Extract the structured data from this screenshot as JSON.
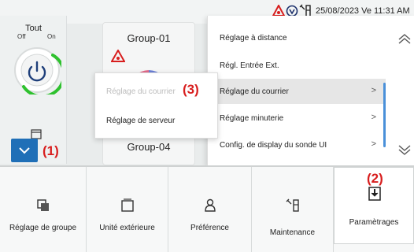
{
  "status": {
    "datetime": "25/08/2023 Ve 11:31 AM"
  },
  "left": {
    "title": "Tout",
    "off": "Off",
    "on": "On"
  },
  "groups": [
    {
      "name": "Group-01"
    },
    {
      "name": "Group-04"
    }
  ],
  "submenu": {
    "items": [
      {
        "label": "Réglage à distance",
        "chevron": false
      },
      {
        "label": "Régl. Entrée Ext.",
        "chevron": false
      },
      {
        "label": "Réglage du courrier",
        "chevron": true,
        "active": true
      },
      {
        "label": "Réglage minuterie",
        "chevron": true
      },
      {
        "label": "Config. de display du sonde UI",
        "chevron": true
      }
    ]
  },
  "popup": {
    "items": [
      {
        "label": "Réglage du courrier",
        "disabled": true
      },
      {
        "label": "Réglage de serveur",
        "disabled": false
      }
    ]
  },
  "annotations": {
    "a1": "(1)",
    "a2": "(2)",
    "a3": "(3)"
  },
  "bottom": {
    "items": [
      {
        "label": "Réglage de groupe",
        "icon": "group-settings-icon"
      },
      {
        "label": "Unité extérieure",
        "icon": "outdoor-unit-icon"
      },
      {
        "label": "Préférence",
        "icon": "preference-icon"
      },
      {
        "label": "Maintenance",
        "icon": "maintenance-icon"
      },
      {
        "label": "Paramètrages",
        "icon": "settings-download-icon"
      }
    ]
  },
  "colors": {
    "accent": "#1f6fb7",
    "annotation": "#d81e1e",
    "on": "#2ec12e"
  }
}
